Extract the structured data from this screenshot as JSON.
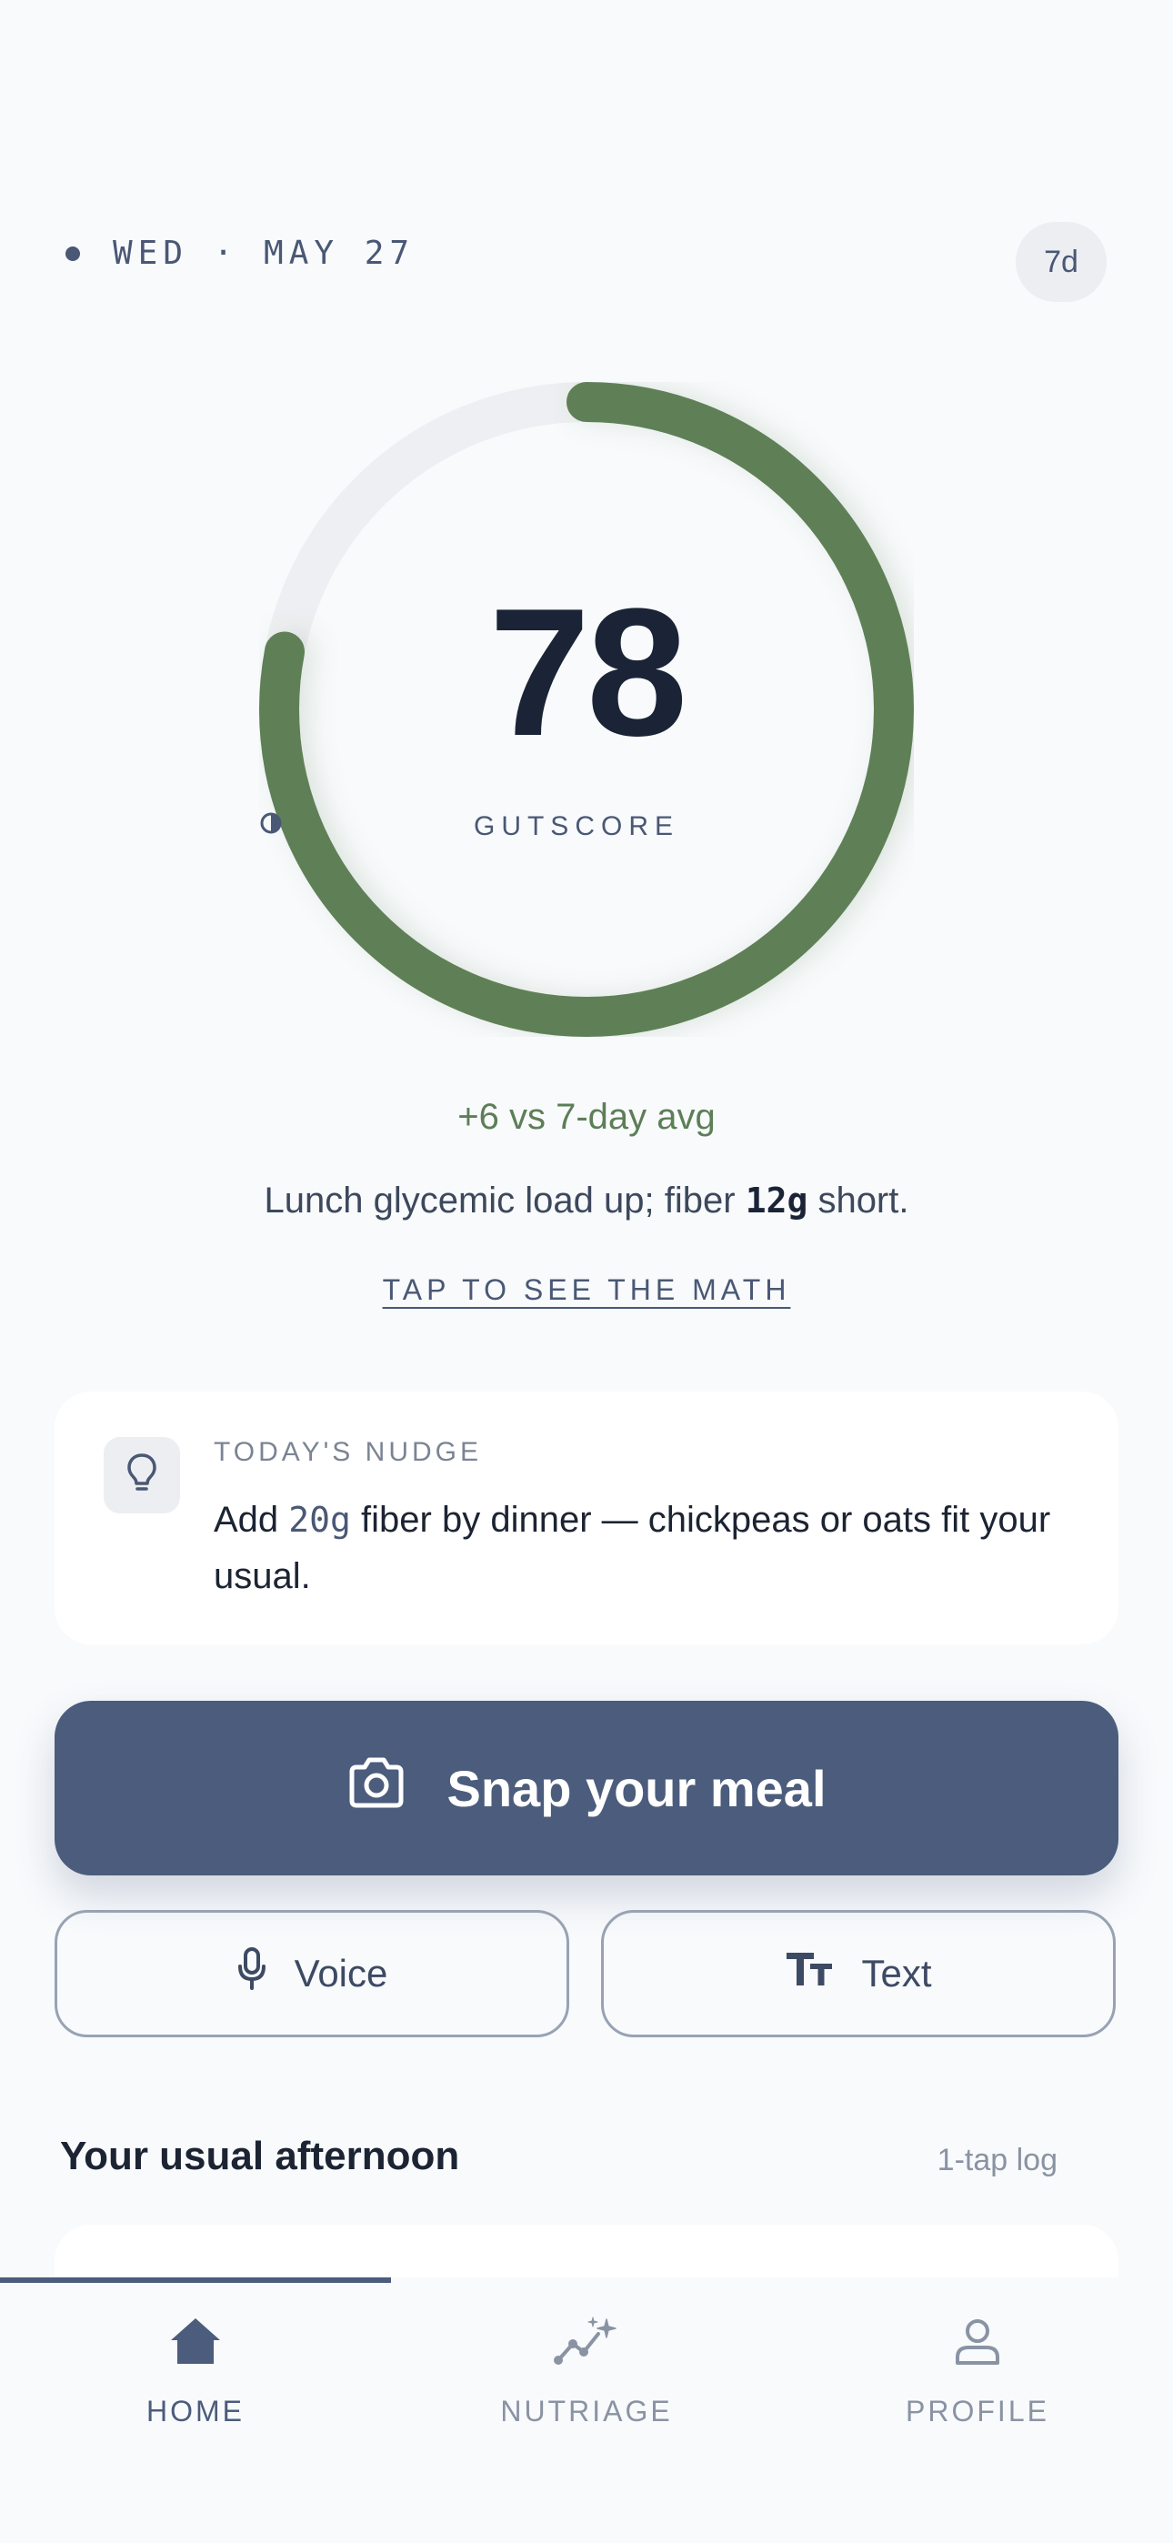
{
  "header": {
    "date": "WED · MAY 27",
    "range_toggle": "7d"
  },
  "gutscore": {
    "value": "78",
    "label": "GUTSCORE",
    "max": 100,
    "delta_text": "+6 vs 7-day avg",
    "insight_prefix": "Lunch glycemic load up; fiber ",
    "insight_amount": "12g",
    "insight_suffix": " short.",
    "math_link": "TAP TO SEE THE MATH",
    "colors": {
      "progress": "#5f8057",
      "track": "#eeeff2"
    }
  },
  "nudge": {
    "title": "TODAY'S NUDGE",
    "text_prefix": "Add ",
    "text_amount": "20g",
    "text_suffix": " fiber by dinner — chickpeas or oats fit your usual.",
    "icon": "lightbulb-icon"
  },
  "actions": {
    "snap_label": "Snap your meal",
    "snap_icon": "camera-icon",
    "voice_label": "Voice",
    "voice_icon": "microphone-icon",
    "text_label": "Text",
    "text_icon": "text-size-icon"
  },
  "usual": {
    "title": "Your usual afternoon",
    "hint": "1-tap log"
  },
  "tabs": [
    {
      "label": "HOME",
      "icon": "home-icon",
      "active": true
    },
    {
      "label": "NUTRIAGE",
      "icon": "trend-sparkle-icon",
      "active": false
    },
    {
      "label": "PROFILE",
      "icon": "person-icon",
      "active": false
    }
  ]
}
